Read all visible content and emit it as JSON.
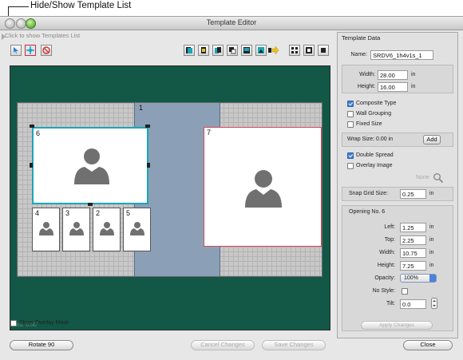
{
  "callout": {
    "label": "Hide/Show Template List"
  },
  "window": {
    "title": "Template Editor",
    "hint": "Click to show Templates List"
  },
  "toolbar": {
    "left_tools": [
      "select-tool-icon",
      "crop-tool-icon",
      "no-entry-icon"
    ],
    "right_tools": [
      "layer-icon-1",
      "layer-icon-2",
      "layer-icon-3",
      "layer-icon-4",
      "layer-icon-5",
      "layer-icon-6",
      "arrow-icon",
      "grid-icon-1",
      "grid-icon-2"
    ]
  },
  "canvas": {
    "background": "#135847",
    "grid_label": "Grid: 0.50\"",
    "spine_number": "1",
    "openings": [
      {
        "number": "6",
        "selected": true
      },
      {
        "number": "7",
        "selected": false
      },
      {
        "number": "4"
      },
      {
        "number": "3"
      },
      {
        "number": "2"
      },
      {
        "number": "5"
      }
    ]
  },
  "overlay": {
    "show_overlay_mask": "Show Overlay Mask"
  },
  "buttons": {
    "rotate": "Rotate 90",
    "cancel": "Cancel Changes",
    "save": "Save Changes",
    "close": "Close"
  },
  "template_data": {
    "section_title": "Template Data",
    "name_label": "Name:",
    "name_value": "SRDV6_1h4v1s_1",
    "width_label": "Width:",
    "width_value": "28.00",
    "height_label": "Height:",
    "height_value": "16.00",
    "unit": "in",
    "composite_type": "Composite Type",
    "wall_grouping": "Wall Grouping",
    "fixed_size": "Fixed Size",
    "wrap_size": "Wrap Size: 0.00 in",
    "add_label": "Add",
    "double_spread": "Double Spread",
    "overlay_image": "Overlay Image",
    "none_label": "None",
    "snap_label": "Snap Grid Size:",
    "snap_value": "0.25",
    "opening_title": "Opening No. 6",
    "left_label": "Left:",
    "left_value": "1.25",
    "top_label": "Top:",
    "top_value": "2.25",
    "owidth_label": "Width:",
    "owidth_value": "10.75",
    "oheight_label": "Height:",
    "oheight_value": "7.25",
    "opacity_label": "Opacity:",
    "opacity_value": "100%",
    "nostyle_label": "No Style:",
    "tilt_label": "Tilt:",
    "tilt_value": "0.0",
    "apply": "Apply Changes"
  },
  "colors": {
    "accent": "#3d7fd6",
    "selected_teal": "#1aa6b7",
    "selected_red": "#d8455a"
  }
}
